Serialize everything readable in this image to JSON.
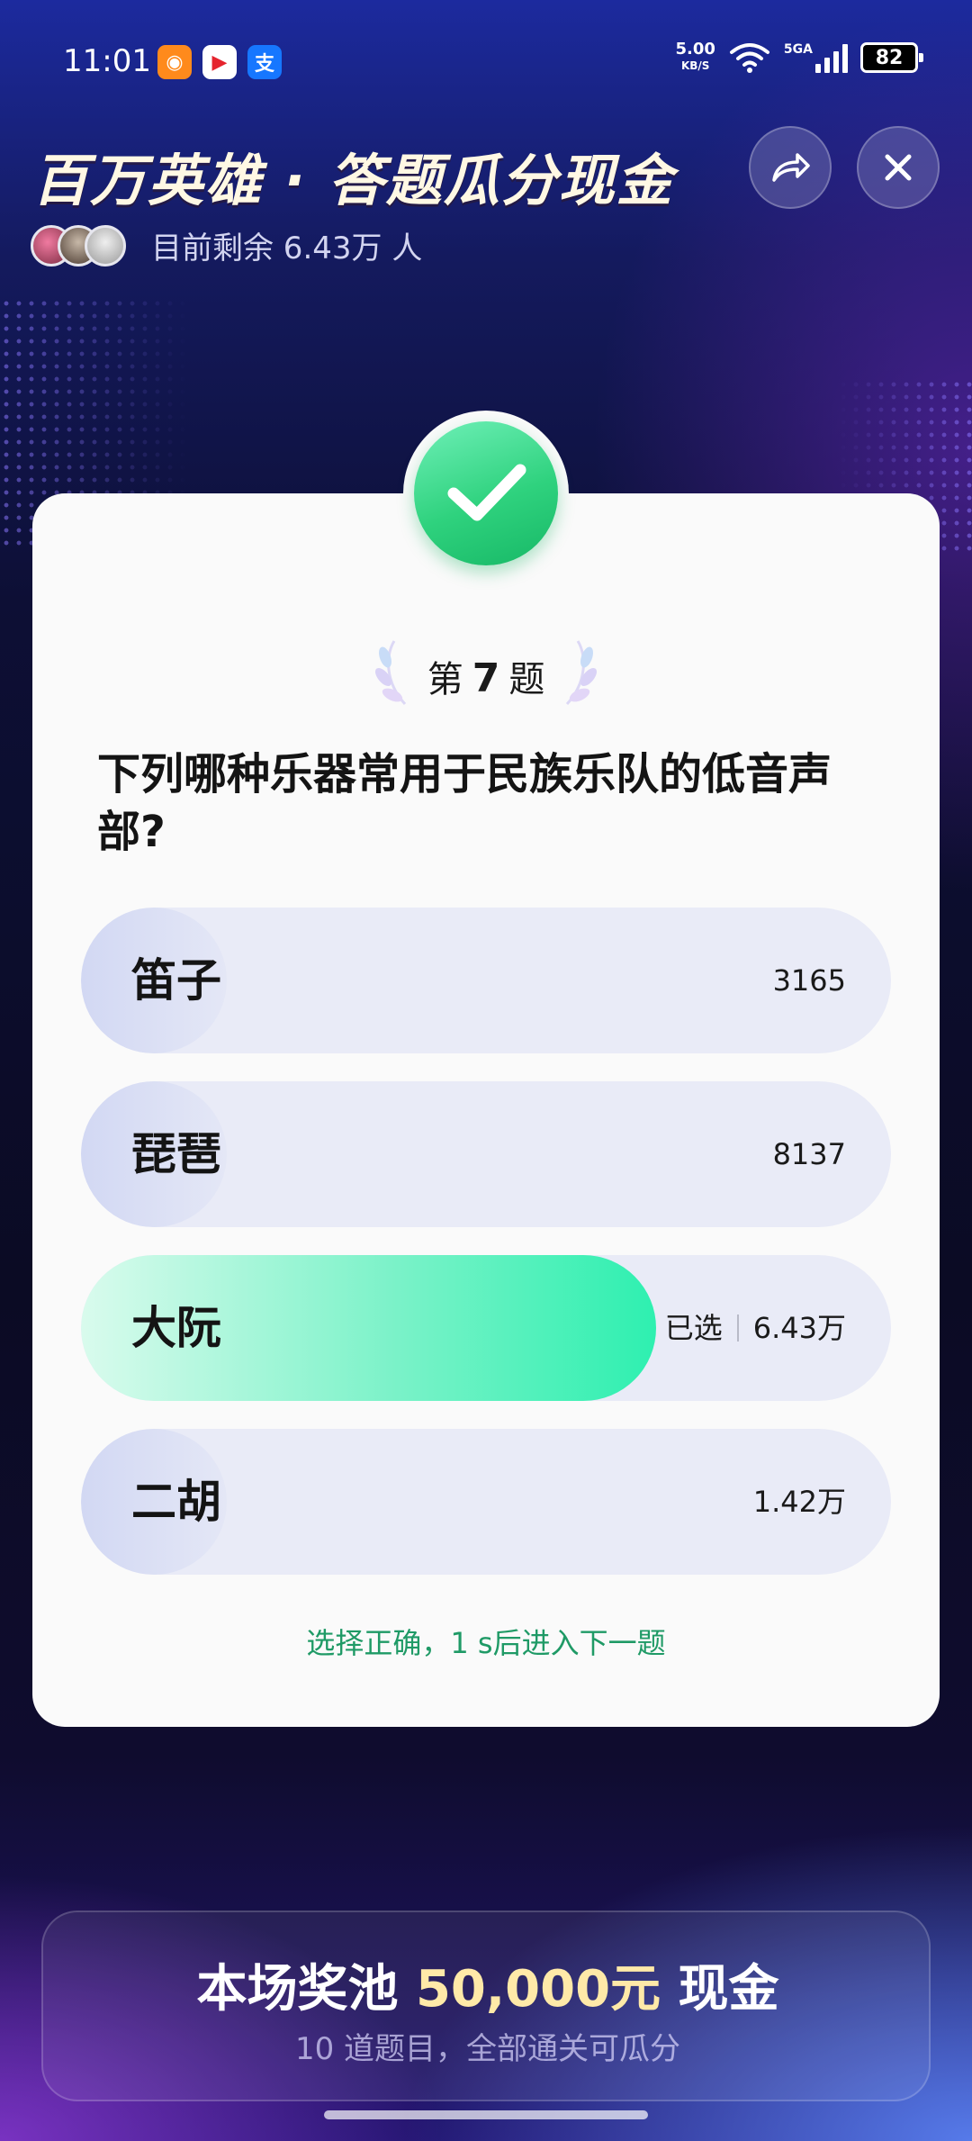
{
  "status_bar": {
    "time": "11:01",
    "net_speed_value": "5.00",
    "net_speed_unit": "KB/S",
    "network_type": "5GA",
    "battery": "82",
    "app_icons": [
      "app-icon-orange",
      "video-app-icon",
      "alipay-icon"
    ],
    "app_icon_glyphs": [
      "◉",
      "▶",
      "支"
    ]
  },
  "header": {
    "title": "百万英雄 · 答题瓜分现金",
    "share_icon": "share-arrow-icon",
    "close_icon": "close-icon",
    "remaining_label": "目前剩余 6.43万 人"
  },
  "card": {
    "check_icon": "checkmark-icon",
    "question_number_prefix": "第",
    "question_number": "7",
    "question_number_suffix": "题",
    "question": "下列哪种乐器常用于民族乐队的低音声部?",
    "options": [
      {
        "label": "笛子",
        "count": "3165",
        "share": 0.18,
        "selected": false
      },
      {
        "label": "琵琶",
        "count": "8137",
        "share": 0.18,
        "selected": false
      },
      {
        "label": "大阮",
        "count": "6.43万",
        "share": 0.71,
        "selected": true,
        "selected_label": "已选"
      },
      {
        "label": "二胡",
        "count": "1.42万",
        "share": 0.18,
        "selected": false
      }
    ],
    "result_message": "选择正确，1 s后进入下一题"
  },
  "prize_pool": {
    "title_prefix": "本场奖池",
    "amount": "50,000元",
    "title_suffix": "现金",
    "subtitle": "10 道题目，全部通关可瓜分"
  },
  "colors": {
    "accent_green": "#2ef0b0",
    "success_text": "#1f9a66",
    "title_cream": "#fff8e4",
    "prize_gold": "#ffe9a8"
  }
}
